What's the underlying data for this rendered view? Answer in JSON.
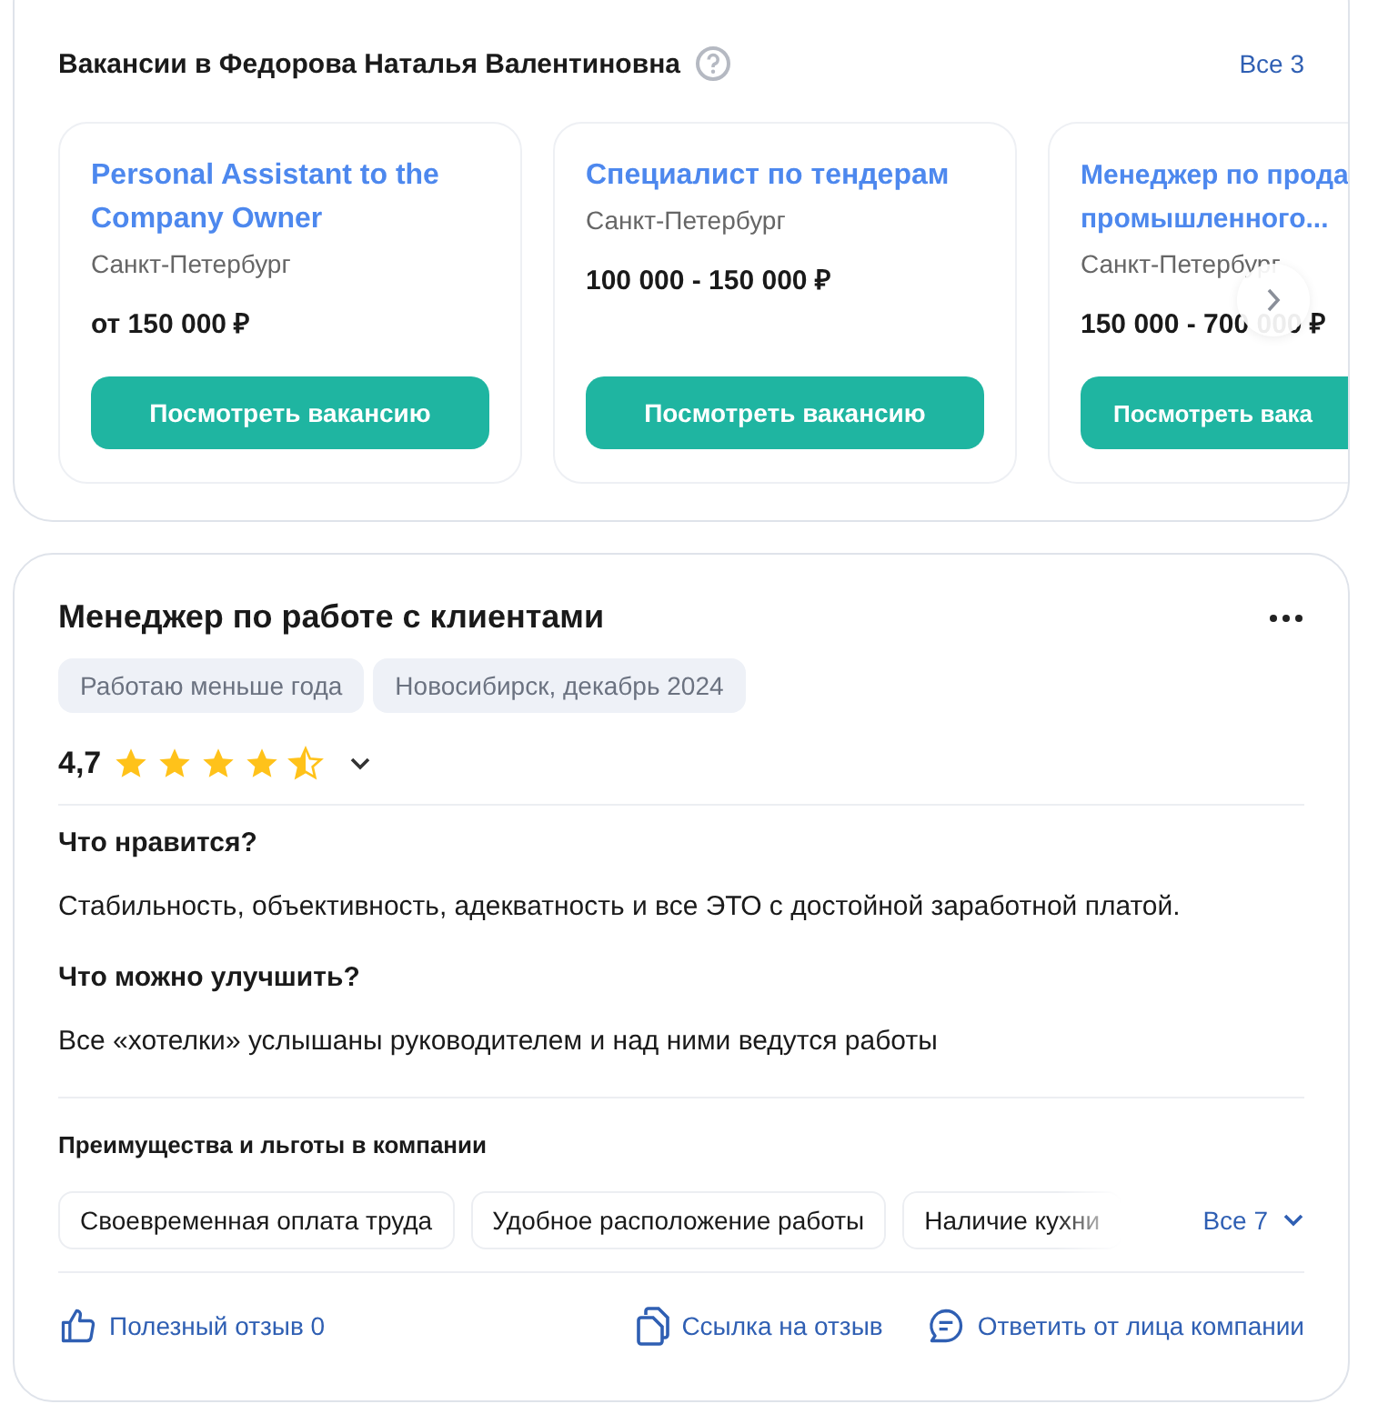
{
  "vacancies": {
    "title": "Вакансии в Федорова Наталья Валентиновна",
    "all_link": "Все 3",
    "cards": [
      {
        "title": "Personal Assistant to the Company Owner",
        "city": "Санкт-Петербург",
        "salary": "от 150 000 ₽",
        "button": "Посмотреть вакансию",
        "cut": false
      },
      {
        "title": "Специалист по тендерам",
        "city": "Санкт-Петербург",
        "salary": "100 000 - 150 000 ₽",
        "button": "Посмотреть вакансию",
        "cut": false
      },
      {
        "title": "Менеджер по прода\nпромышленного...",
        "city": "Санкт-Петербург",
        "salary": "150 000 - 700 000 ₽",
        "button": "Посмотреть вака",
        "cut": true
      }
    ]
  },
  "review": {
    "title": "Менеджер по работе с клиентами",
    "tags": [
      "Работаю меньше года",
      "Новосибирск, декабрь 2024"
    ],
    "rating": "4,7",
    "stars": 4.5,
    "sections": [
      {
        "heading": "Что нравится?",
        "text": "Стабильность, объективность, адекватность и все ЭТО с достойной заработной платой."
      },
      {
        "heading": "Что можно улучшить?",
        "text": "Все «хотелки» услышаны руководителем и над ними ведутся работы"
      }
    ],
    "benefits": {
      "heading": "Преимущества и льготы в компании",
      "items": [
        "Своевременная оплата труда",
        "Удобное расположение работы",
        "Наличие кухни"
      ],
      "all_link": "Все 7"
    },
    "actions": [
      {
        "kind": "like",
        "label": "Полезный отзыв 0"
      },
      {
        "kind": "link",
        "label": "Ссылка на отзыв"
      },
      {
        "kind": "reply",
        "label": "Ответить от лица компании"
      }
    ]
  }
}
